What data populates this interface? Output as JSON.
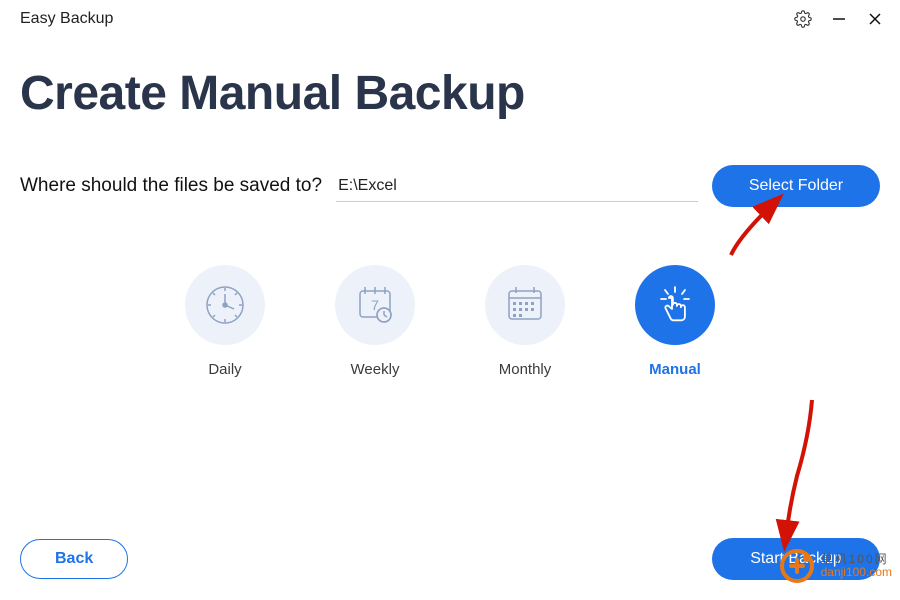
{
  "app": {
    "title": "Easy Backup"
  },
  "controls": {
    "settings_icon": "gear-icon",
    "minimize_icon": "minimize-icon",
    "close_icon": "close-icon"
  },
  "page": {
    "heading": "Create Manual Backup",
    "dest_label": "Where should the files be saved to?",
    "dest_value": "E:\\Excel",
    "select_folder": "Select Folder"
  },
  "frequency": {
    "options": [
      {
        "id": "daily",
        "label": "Daily",
        "icon": "clock-icon",
        "active": false
      },
      {
        "id": "weekly",
        "label": "Weekly",
        "icon": "calendar-week-icon",
        "active": false
      },
      {
        "id": "monthly",
        "label": "Monthly",
        "icon": "calendar-month-icon",
        "active": false
      },
      {
        "id": "manual",
        "label": "Manual",
        "icon": "pointer-icon",
        "active": true
      }
    ]
  },
  "footer": {
    "back": "Back",
    "start": "Start Backup"
  },
  "watermark": {
    "line1": "单机100网",
    "line2": "danji100.com"
  },
  "colors": {
    "accent": "#1e73e8",
    "icon_muted": "#8fa2c2",
    "circle_bg": "#edf1f9",
    "arrow": "#d11204"
  }
}
